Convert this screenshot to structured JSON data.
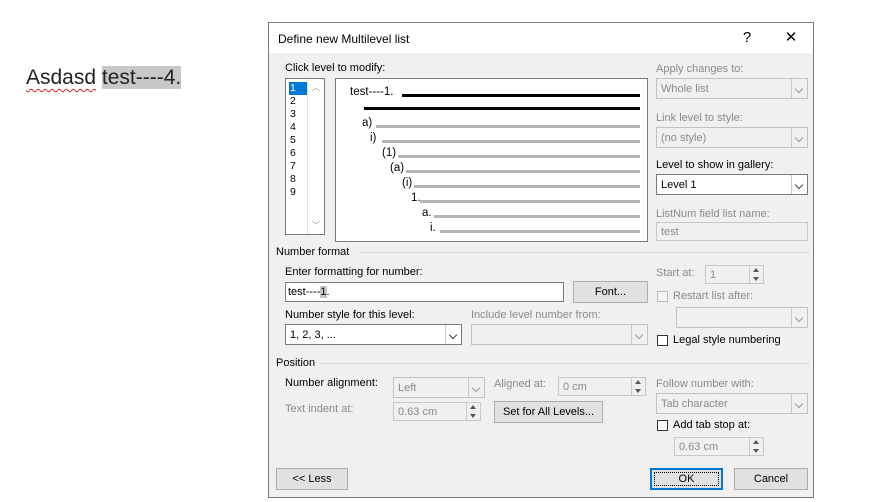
{
  "document": {
    "word1": "Asdasd",
    "word2": "test----4."
  },
  "dialog": {
    "title": "Define new Multilevel list",
    "help": "?",
    "close": "✕",
    "click_level_label": "Click level to modify:",
    "levels": [
      "1",
      "2",
      "3",
      "4",
      "5",
      "6",
      "7",
      "8",
      "9"
    ],
    "selected_level": "1",
    "preview": {
      "items": [
        "test----1.",
        "a)",
        "i)",
        "(1)",
        "(a)",
        "(i)",
        "1.",
        "a.",
        "i."
      ]
    },
    "apply_changes": {
      "label": "Apply changes to:",
      "value": "Whole list"
    },
    "link_level": {
      "label": "Link level to style:",
      "value": "(no style)"
    },
    "gallery_level": {
      "label": "Level to show in gallery:",
      "value": "Level 1"
    },
    "listnum": {
      "label": "ListNum field list name:",
      "value": "test"
    },
    "number_format": {
      "section": "Number format",
      "enter_label": "Enter formatting for number:",
      "value_prefix": "test----",
      "value_num": "1",
      "value_suffix": ".",
      "font_button": "Font...",
      "style_label": "Number style for this level:",
      "style_value": "1, 2, 3, ...",
      "include_label": "Include level number from:",
      "include_value": ""
    },
    "start_at": {
      "label": "Start at:",
      "value": "1"
    },
    "restart": {
      "label": "Restart list after:",
      "value": ""
    },
    "legal": {
      "label": "Legal style numbering"
    },
    "position": {
      "section": "Position",
      "alignment_label": "Number alignment:",
      "alignment_value": "Left",
      "aligned_at_label": "Aligned at:",
      "aligned_at_value": "0 cm",
      "indent_label": "Text indent at:",
      "indent_value": "0.63 cm",
      "set_all_button": "Set for All Levels...",
      "follow_label": "Follow number with:",
      "follow_value": "Tab character",
      "tab_stop_label": "Add tab stop at:",
      "tab_stop_value": "0.63 cm"
    },
    "less_button": "<< Less",
    "ok_button": "OK",
    "cancel_button": "Cancel"
  }
}
